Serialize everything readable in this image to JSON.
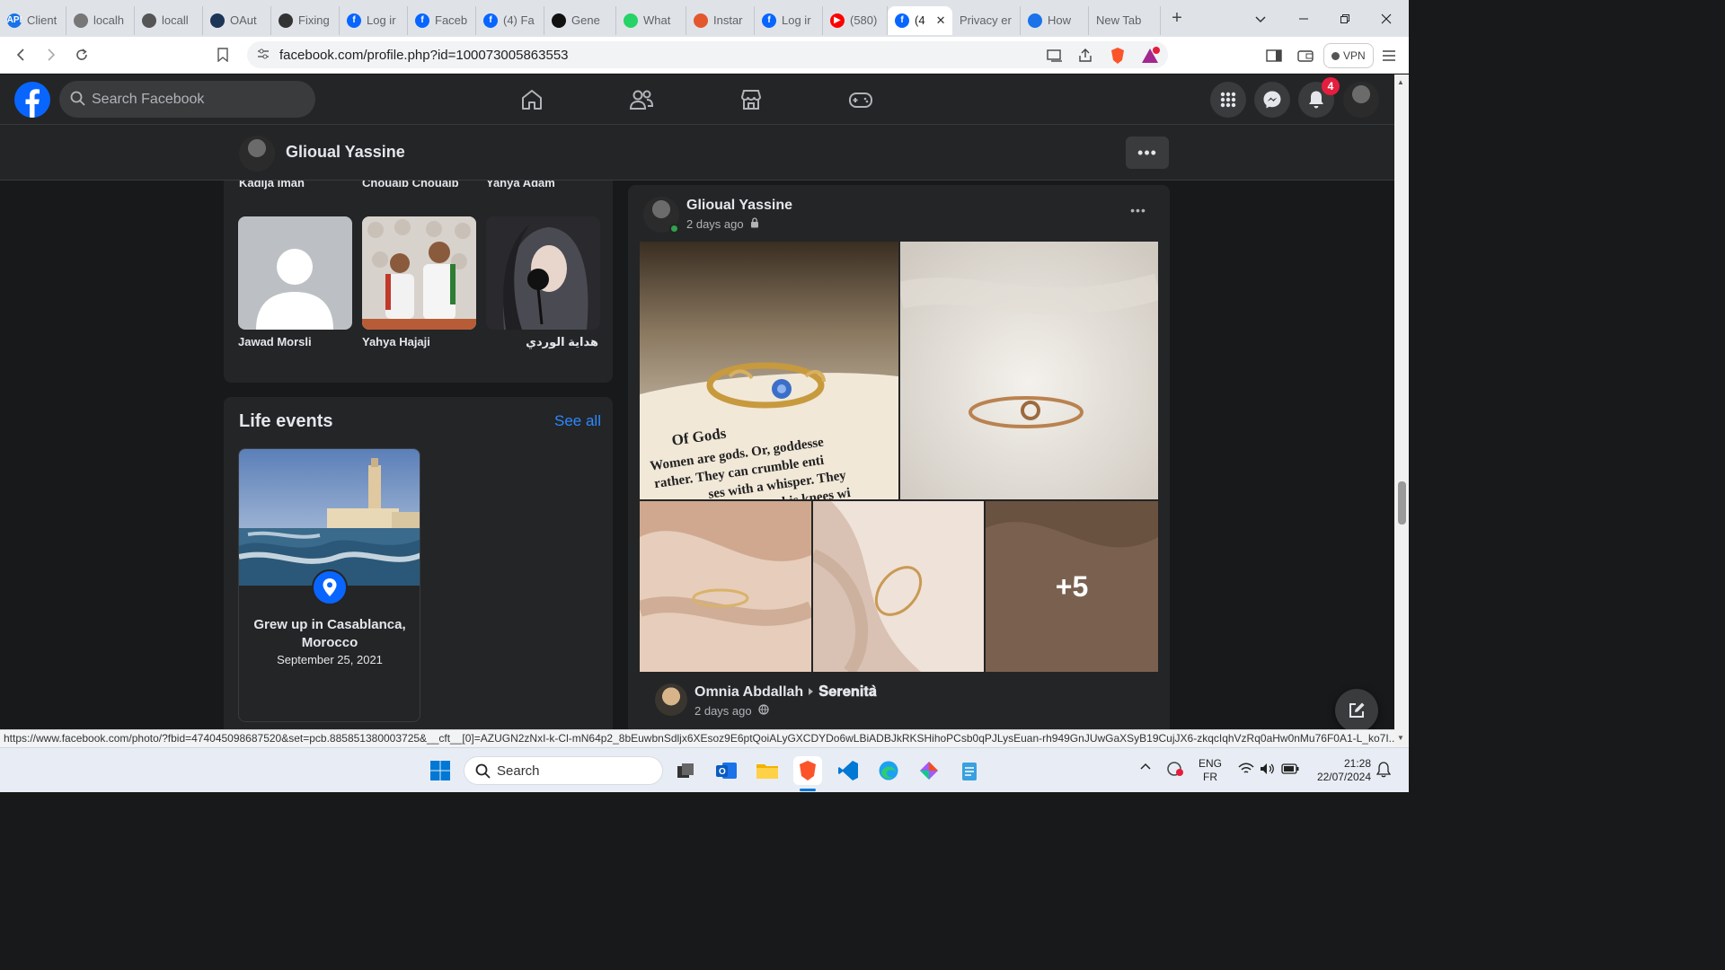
{
  "browser": {
    "tabs": [
      {
        "label": "Client",
        "fav_text": "API",
        "fav_color": "#1a73e8"
      },
      {
        "label": "localh",
        "fav_text": "",
        "fav_color": "#777777"
      },
      {
        "label": "locall",
        "fav_text": "",
        "fav_color": "#555555"
      },
      {
        "label": "OAut",
        "fav_text": "",
        "fav_color": "#1d3557"
      },
      {
        "label": "Fixing",
        "fav_text": "",
        "fav_color": "#333333"
      },
      {
        "label": "Log ir",
        "fav_text": "f",
        "fav_color": "#0866ff"
      },
      {
        "label": "Faceb",
        "fav_text": "f",
        "fav_color": "#0866ff"
      },
      {
        "label": "(4) Fa",
        "fav_text": "f",
        "fav_color": "#0866ff"
      },
      {
        "label": "Gene",
        "fav_text": "",
        "fav_color": "#111111"
      },
      {
        "label": "What",
        "fav_text": "",
        "fav_color": "#25d366"
      },
      {
        "label": "Instar",
        "fav_text": "",
        "fav_color": "#e4572e"
      },
      {
        "label": "Log ir",
        "fav_text": "f",
        "fav_color": "#0866ff"
      },
      {
        "label": "(580)",
        "fav_text": "▶",
        "fav_color": "#ff0000"
      },
      {
        "label": "(4",
        "fav_text": "f",
        "fav_color": "#0866ff",
        "active": true
      },
      {
        "label": "Privacy er",
        "fav_text": "",
        "fav_color": ""
      },
      {
        "label": "How",
        "fav_text": "",
        "fav_color": "#1a73e8"
      },
      {
        "label": "New Tab",
        "fav_text": "",
        "fav_color": ""
      }
    ],
    "url": "facebook.com/profile.php?id=100073005863553",
    "vpn_label": "VPN",
    "status_url": "https://www.facebook.com/photo/?fbid=474045098687520&set=pcb.885851380003725&__cft__[0]=AZUGN2zNxI-k-Cl-mN64p2_8bEuwbnSdljx6XEsoz9E6ptQoiALyGXCDYDo6wLBiADBJkRKSHihoPCsb0qPJLysEuan-rh949GnJUwGaXSyB19CujJX6-zkqcIqhVzRq0aHw0nMu76F0A1-L_ko7I..."
  },
  "facebook": {
    "search_placeholder": "Search Facebook",
    "notification_count": "4",
    "brand_color": "#0866ff",
    "profile": {
      "name": "Glioual Yassine"
    },
    "friends": {
      "top_row_names": [
        "Kadija Iman",
        "Chouaib Chouaib",
        "Yahya Adam"
      ],
      "cards": [
        {
          "name": "Jawad Morsli",
          "photo": "default-avatar"
        },
        {
          "name": "Yahya Hajaji",
          "photo": "two-boys-photo"
        },
        {
          "name": "هداية الوردي",
          "photo": "girl-with-rose-photo"
        }
      ]
    },
    "life_events": {
      "title": "Life events",
      "see_all": "See all",
      "event": {
        "text": "Grew up in Casablanca, Morocco",
        "date": "September 25, 2021",
        "icon": "location-pin-icon"
      }
    },
    "post": {
      "author": "Glioual Yassine",
      "time": "2 days ago",
      "privacy_icon": "lock-icon",
      "photos": [
        "ring-on-book",
        "knot-ring",
        "ring-fabric-1",
        "ring-fabric-2",
        "ring-fabric-3"
      ],
      "book_text": [
        "Of Gods",
        "Women are gods. Or, goddesse",
        "rather. They can crumble enti",
        "ses with a whisper. They",
        "his knees wi"
      ],
      "more_photos": "+5"
    },
    "shared_post": {
      "author": "Omnia Abdallah",
      "group": "𝐒𝐞𝐫𝐞𝐧𝐢𝐭𝐚̀",
      "time": "2 days ago",
      "privacy_icon": "globe-icon"
    }
  },
  "taskbar": {
    "search_label": "Search",
    "lang_top": "ENG",
    "lang_bottom": "FR",
    "time": "21:28",
    "date": "22/07/2024"
  }
}
